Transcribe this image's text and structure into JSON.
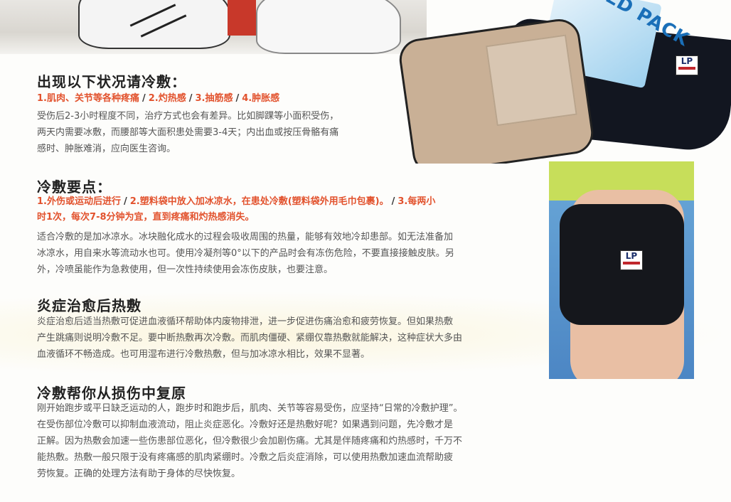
{
  "top_image": {
    "icon": "running-shoes-photo"
  },
  "cold_pack_image": {
    "label": "COLD PACK",
    "brand": "LP",
    "icon": "cold-pack-photo"
  },
  "knee_image": {
    "brand": "LP",
    "icon": "knee-brace-photo"
  },
  "sections": [
    {
      "title": "出现以下状况请冷敷：",
      "highlights": [
        "1.肌肉、关节等各种疼痛",
        "2.灼热感",
        "3.抽筋感",
        "4.肿胀感"
      ],
      "lines": [
        "受伤后2-3小时程度不同，治疗方式也会有差异。比如脚踝等小面积受伤，",
        "两天内需要冰敷，而腰部等大面积患处需要3-4天；内出血或按压骨骼有痛",
        "感时、肿胀难消，应向医生咨询。"
      ]
    },
    {
      "title": "冷敷要点：",
      "highlight_line1": [
        "1.外伤或运动后进行",
        "2.塑料袋中放入加冰凉水，在患处冷敷(塑料袋外用毛巾包裹)。",
        "3.每两小"
      ],
      "highlight_line2": "时1次，每次7-8分钟为宜，直到疼痛和灼热感消失。",
      "lines": [
        "适合冷敷的是加冰凉水。冰块融化成水的过程会吸收周围的热量，能够有效地冷却患部。如无法准备加",
        "冰凉水，用自来水等流动水也可。使用冷凝剂等0°以下的产品时会有冻伤危险，不要直接接触皮肤。另",
        "外，冷喷虽能作为急救使用，但一次性持续使用会冻伤皮肤，也要注意。"
      ]
    },
    {
      "title": "炎症治愈后热敷",
      "lines": [
        "炎症治愈后适当热敷可促进血液循环帮助体内废物排泄，进一步促进伤痛治愈和疲劳恢复。但如果热敷",
        "产生跳痛则说明冷敷不足。要中断热敷再次冷敷。而肌肉僵硬、紧绷仅靠热敷就能解决，这种症状大多由",
        "血液循环不畅造成。也可用湿布进行冷敷热敷，但与加冰凉水相比，效果不显著。"
      ]
    },
    {
      "title": "冷敷帮你从损伤中复原",
      "lines": [
        "刚开始跑步或平日缺乏运动的人，跑步时和跑步后，肌肉、关节等容易受伤，应坚持“日常的冷敷护理”。",
        "在受伤部位冷敷可以抑制血液流动，阻止炎症恶化。冷敷好还是热敷好呢？如果遇到问题，先冷敷才是",
        "正解。因为热敷会加速一些伤患部位恶化，但冷敷很少会加剧伤痛。尤其是伴随疼痛和灼热感时，千万不",
        "能热敷。热敷一般只限于没有疼痛感的肌肉紧绷时。冷敷之后炎症消除，可以使用热敷加速血流帮助疲",
        "劳恢复。正确的处理方法有助于身体的尽快恢复。"
      ]
    }
  ],
  "colors": {
    "highlight": "#e2522d",
    "heading": "#222222",
    "body": "#555555"
  }
}
